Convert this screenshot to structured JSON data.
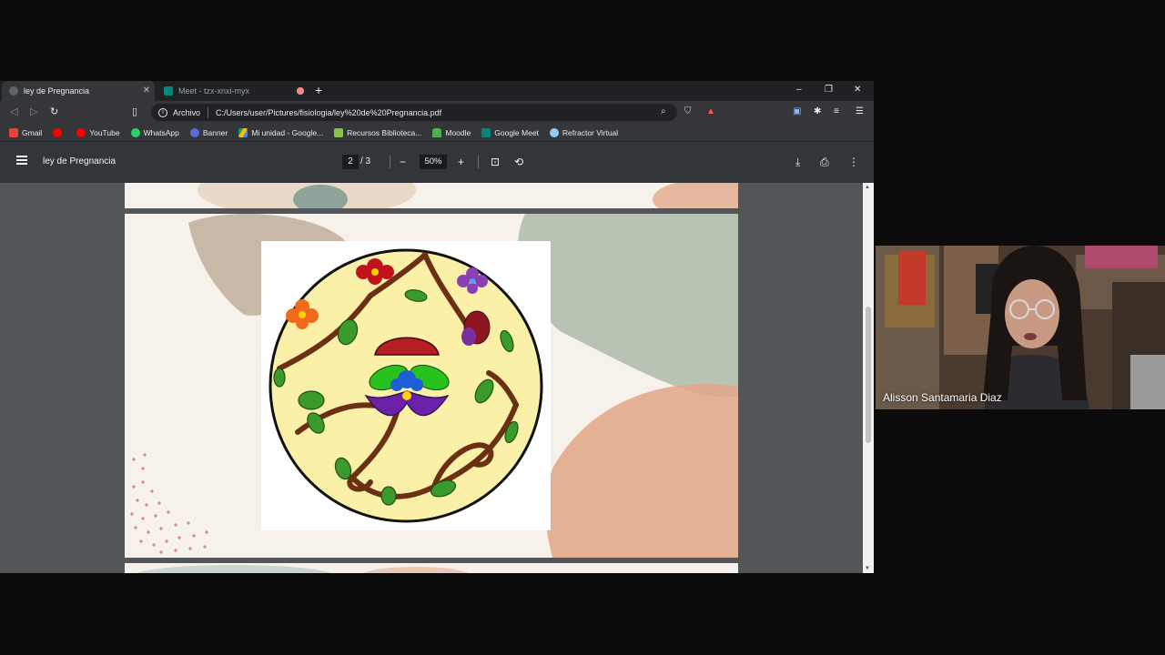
{
  "browser": {
    "tabs": [
      {
        "label": "ley de Pregnancia",
        "active": true
      },
      {
        "label": "Meet - tzx-xnxi-myx",
        "active": false,
        "recording": true
      }
    ],
    "new_tab_symbol": "+",
    "window_controls": {
      "minimize": "–",
      "restore": "❐",
      "close": "✕"
    },
    "address": {
      "scheme_label": "Archivo",
      "url": "C:/Users/user/Pictures/fisiologia/ley%20de%20Pregnancia.pdf"
    },
    "bookmarks": [
      {
        "label": "Gmail",
        "color": "#ea4335"
      },
      {
        "label": "",
        "color": "#ff0000"
      },
      {
        "label": "YouTube",
        "color": "#ff0000"
      },
      {
        "label": "WhatsApp",
        "color": "#25d366"
      },
      {
        "label": "Banner",
        "color": "#5b6bd6"
      },
      {
        "label": "Mi unidad - Google...",
        "color": "#fbbc04"
      },
      {
        "label": "Recursos Biblioteca...",
        "color": "#8bc34a"
      },
      {
        "label": "Moodle",
        "color": "#4caf50"
      },
      {
        "label": "Google Meet",
        "color": "#00897b"
      },
      {
        "label": "Refractor Virtual",
        "color": "#90caf9"
      }
    ]
  },
  "pdf": {
    "title": "ley de Pregnancia",
    "current_page": "2",
    "total_pages": "/  3",
    "zoom": "50%",
    "icons": {
      "zoom_out": "−",
      "zoom_in": "+",
      "fit": "⊡",
      "rotate": "⟲",
      "download": "⤓",
      "print": "⎙",
      "more": "⋮"
    }
  },
  "meet": {
    "participant_name": "Alisson Santamaria Diaz"
  },
  "colors": {
    "tab_bg": "#202124",
    "toolbar_bg": "#35363a",
    "pdf_toolbar": "#323639",
    "pdf_viewport": "#525659",
    "illustration_circle": "#fbf0a8"
  }
}
